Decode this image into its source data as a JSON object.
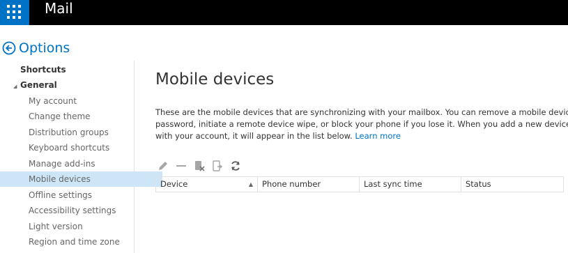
{
  "app": {
    "title": "Mail"
  },
  "options": {
    "title": "Options"
  },
  "nav": {
    "shortcuts": "Shortcuts",
    "general": "General",
    "items": [
      "My account",
      "Change theme",
      "Distribution groups",
      "Keyboard shortcuts",
      "Manage add-ins",
      "Mobile devices",
      "Offline settings",
      "Accessibility settings",
      "Light version",
      "Region and time zone"
    ],
    "selected": "Mobile devices"
  },
  "page": {
    "title": "Mobile devices",
    "desc_line1": "These are the mobile devices that are synchronizing with your mailbox. You can remove a mobile device, access y",
    "desc_line2": "password, initiate a remote device wipe, or block your phone if you lose it. When you add a new device and set i",
    "desc_line3": "with your account, it will appear in the list below.",
    "learn_more": "Learn more"
  },
  "toolbar": {
    "icons": [
      "edit-icon",
      "remove-icon",
      "wipe-device-icon",
      "block-device-icon",
      "refresh-icon"
    ]
  },
  "table": {
    "columns": [
      "Device",
      "Phone number",
      "Last sync time",
      "Status"
    ],
    "sort_indicator": "▲"
  },
  "colors": {
    "accent": "#0072c6",
    "topbar": "#000000",
    "selected_nav": "#cde6f7"
  }
}
